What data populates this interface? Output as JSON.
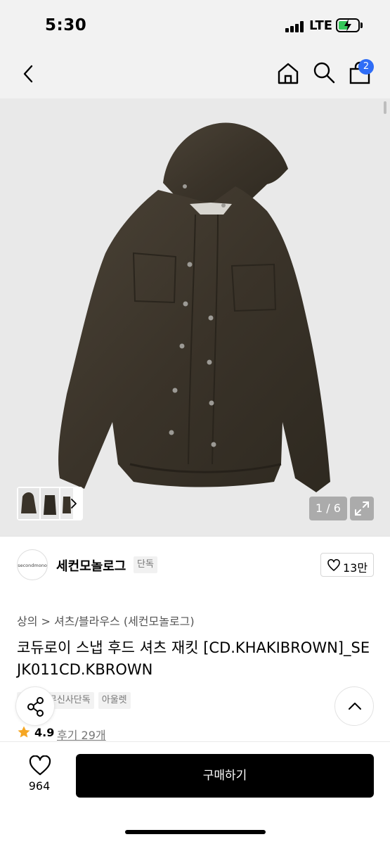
{
  "status_bar": {
    "time": "5:30",
    "network": "LTE",
    "battery_level": 0.5,
    "battery_charging": true
  },
  "nav": {
    "back_icon": "chevron-left-icon",
    "home_icon": "home-icon",
    "search_icon": "search-icon",
    "cart_icon": "shopping-bag-icon",
    "cart_badge": "2",
    "cart_badge_color": "#2f6df6"
  },
  "product_image": {
    "counter": "1 / 6",
    "expand_icon": "expand-icon",
    "thumb_arrow_icon": "chevron-right-icon"
  },
  "brand": {
    "logo_text": "secondmono",
    "name": "세컨모놀로그",
    "tag": "단독",
    "like_icon": "heart-outline-icon",
    "like_count": "13만"
  },
  "category": {
    "level1": "상의",
    "separator": ">",
    "level2": "셔츠/블라우스 (세컨모놀로그)"
  },
  "product": {
    "title": "코듀로이 스냅 후드 셔츠 재킷 [CD.KHAKIBROWN]_SEJK011CD.KBROWN",
    "tags": [
      "단독",
      "무신사단독",
      "아울렛"
    ],
    "rating": "4.9",
    "reviews": "후기 29개",
    "rating_color": "#f5a623"
  },
  "floating": {
    "share_icon": "share-icon",
    "top_icon": "chevron-up-icon"
  },
  "bottom_bar": {
    "wish_icon": "heart-outline-icon",
    "wish_count": "964",
    "buy_label": "구매하기"
  }
}
